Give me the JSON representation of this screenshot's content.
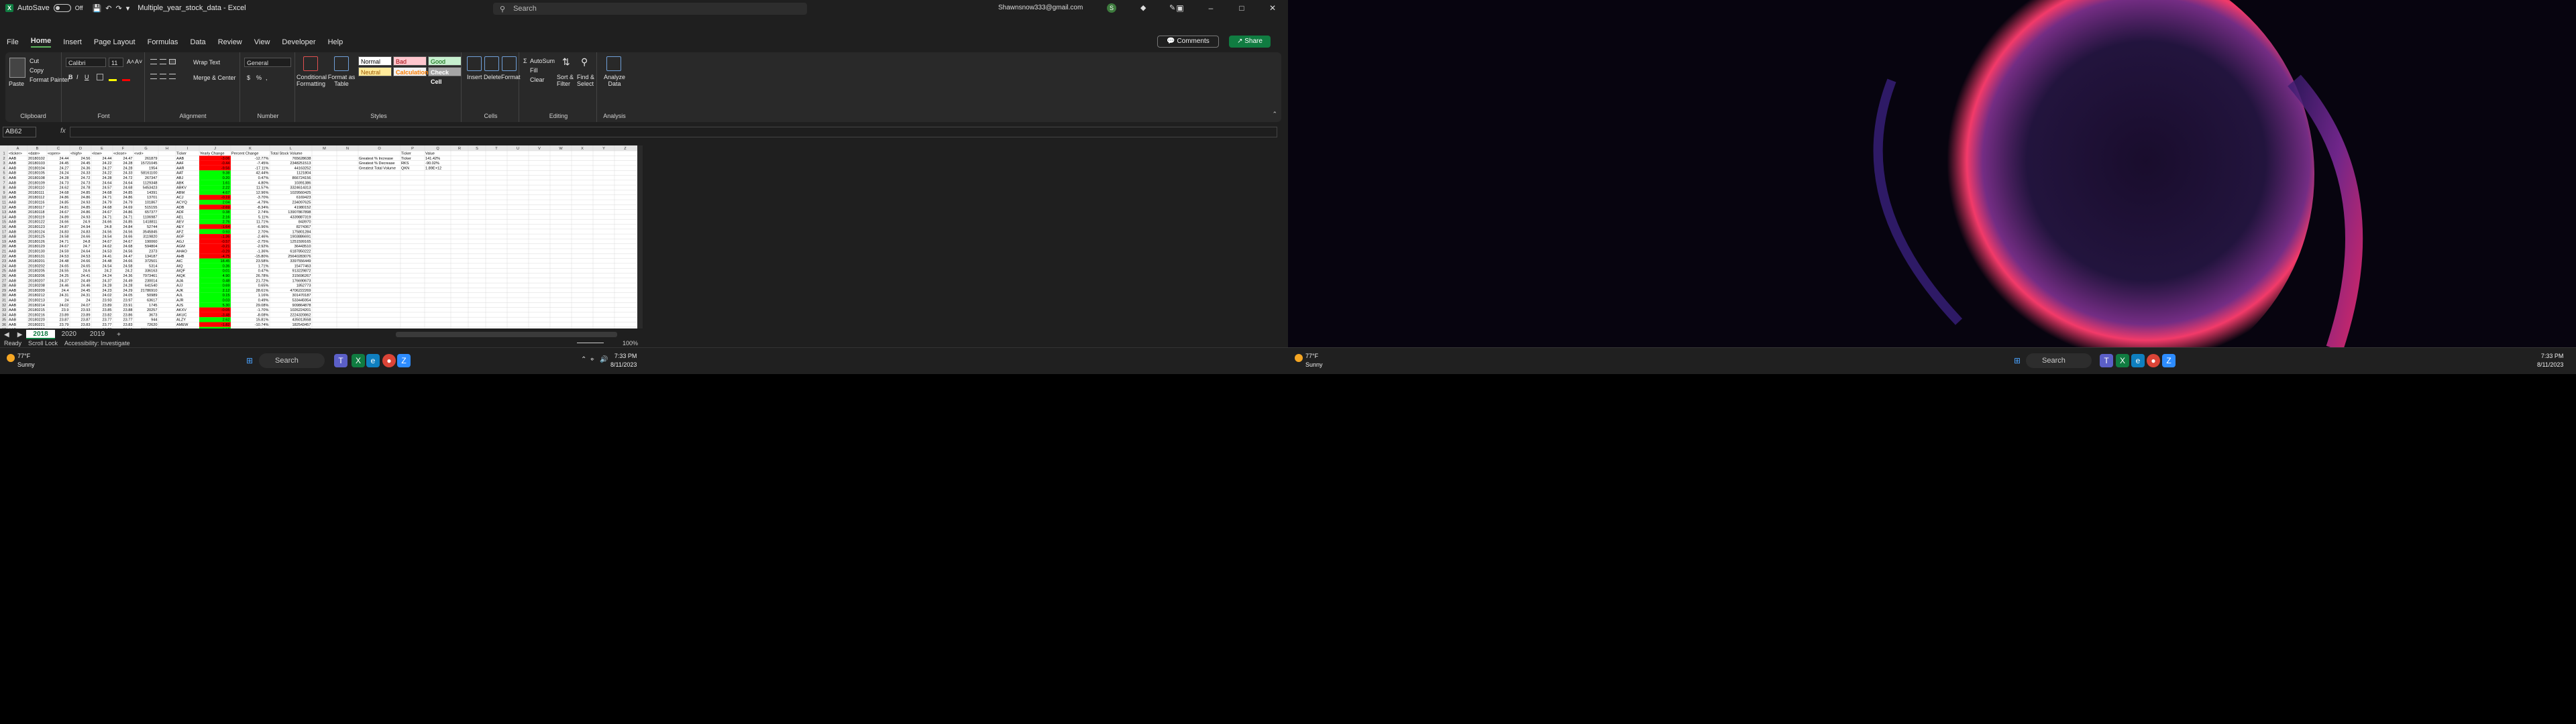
{
  "window": {
    "autosave_label": "AutoSave",
    "autosave_state": "Off",
    "doc_title": "Multiple_year_stock_data  -  Excel",
    "search_placeholder": "Search",
    "account_email": "Shawnsnow333@gmail.com",
    "avatar_letter": "S"
  },
  "menu": [
    "File",
    "Home",
    "Insert",
    "Page Layout",
    "Formulas",
    "Data",
    "Review",
    "View",
    "Developer",
    "Help"
  ],
  "menu_active": "Home",
  "buttons": {
    "comments": "Comments",
    "share": "Share"
  },
  "ribbon": {
    "clipboard": {
      "paste": "Paste",
      "cut": "Cut",
      "copy": "Copy",
      "format_painter": "Format Painter",
      "label": "Clipboard"
    },
    "font": {
      "name": "Calibri",
      "size": "11",
      "label": "Font",
      "grow": "A˄",
      "shrink": "A˅",
      "bold": "B",
      "italic": "I",
      "underline": "U"
    },
    "alignment": {
      "wrap": "Wrap Text",
      "merge": "Merge & Center",
      "label": "Alignment"
    },
    "number": {
      "format": "General",
      "label": "Number",
      "currency": "$",
      "percent": "%",
      "comma": ","
    },
    "styles": {
      "cond": "Conditional Formatting",
      "format_table": "Format as Table",
      "normal": "Normal",
      "bad": "Bad",
      "good": "Good",
      "neutral": "Neutral",
      "calculation": "Calculation",
      "check_cell": "Check Cell",
      "label": "Styles"
    },
    "cells": {
      "insert": "Insert",
      "delete": "Delete",
      "format": "Format",
      "label": "Cells"
    },
    "editing": {
      "autosum": "AutoSum",
      "fill": "Fill",
      "clear": "Clear",
      "sort": "Sort & Filter",
      "find": "Find & Select",
      "label": "Editing"
    },
    "analysis": {
      "analyze": "Analyze Data",
      "label": "Analysis"
    }
  },
  "formula": {
    "namebox": "AB62",
    "fx": "fx"
  },
  "columns": [
    "A",
    "B",
    "C",
    "D",
    "E",
    "F",
    "G",
    "H",
    "I",
    "J",
    "K",
    "L",
    "M",
    "N",
    "O",
    "P",
    "Q",
    "R",
    "S",
    "T",
    "U",
    "V",
    "W",
    "X",
    "Y",
    "Z"
  ],
  "headers": [
    "<ticker>",
    "<date>",
    "<open>",
    "<high>",
    "<low>",
    "<close>",
    "<vol>",
    "",
    "Ticker",
    "Yearly Change",
    "Percent Change",
    "Total Stock Volume"
  ],
  "rows": [
    [
      "AAB",
      "20180102",
      "24.44",
      "24.56",
      "24.44",
      "24.47",
      "261879",
      "",
      "AAB",
      "-3.06",
      "-12.77%",
      "765628638"
    ],
    [
      "AAB",
      "20180103",
      "24.45",
      "24.45",
      "24.22",
      "24.28",
      "15721045",
      "",
      "AAF",
      "-0.44",
      "-7.45%",
      "2348251513"
    ],
    [
      "AAB",
      "20180104",
      "24.27",
      "24.36",
      "24.27",
      "24.28",
      "1954",
      "",
      "AAR",
      "-9.56",
      "-17.11%",
      "44163252"
    ],
    [
      "AAB",
      "20180105",
      "24.24",
      "24.33",
      "24.22",
      "24.33",
      "58161100",
      "",
      "AAT",
      "9.38",
      "42.44%",
      "1121804"
    ],
    [
      "AAB",
      "20180108",
      "24.28",
      "24.72",
      "24.28",
      "24.72",
      "267347",
      "",
      "ABJ",
      "0.20",
      "0.47%",
      "866724156"
    ],
    [
      "AAB",
      "20180109",
      "24.73",
      "24.73",
      "24.64",
      "24.64",
      "1129348",
      "",
      "ABK",
      "1.61",
      "4.80%",
      "10391386"
    ],
    [
      "AAB",
      "20180110",
      "24.62",
      "24.78",
      "24.57",
      "24.68",
      "5453423",
      "",
      "ABKV",
      "2.22",
      "11.57%",
      "3324614313"
    ],
    [
      "AAB",
      "20180111",
      "24.68",
      "24.85",
      "24.68",
      "24.85",
      "14391",
      "",
      "ABM",
      "4.67",
      "12.96%",
      "1029560425"
    ],
    [
      "AAB",
      "20180112",
      "24.86",
      "24.86",
      "24.71",
      "24.86",
      "13701",
      "",
      "ACJ",
      "-0.19",
      "-3.70%",
      "6169423"
    ],
    [
      "AAB",
      "20180116",
      "24.85",
      "24.93",
      "24.79",
      "24.79",
      "101867",
      "",
      "ACYQ",
      "2.04",
      "-4.79%",
      "234097625"
    ],
    [
      "AAB",
      "20180117",
      "24.81",
      "24.85",
      "24.68",
      "24.69",
      "515155",
      "",
      "ADB",
      "-2.69",
      "-8.34%",
      "41980152"
    ],
    [
      "AAB",
      "20180118",
      "24.67",
      "24.86",
      "24.67",
      "24.86",
      "657377",
      "",
      "ADF",
      "0.38",
      "2.74%",
      "13907867898"
    ],
    [
      "AAB",
      "20180119",
      "24.89",
      "24.93",
      "24.71",
      "24.71",
      "1106987",
      "",
      "AEL",
      "2.16",
      "5.11%",
      "4339887319"
    ],
    [
      "AAB",
      "20180122",
      "24.66",
      "24.9",
      "24.66",
      "24.85",
      "1418811",
      "",
      "AEV",
      "2.76",
      "11.71%",
      "843970"
    ],
    [
      "AAB",
      "20180123",
      "24.87",
      "24.94",
      "24.8",
      "24.84",
      "52744",
      "",
      "AEY",
      "-1.64",
      "-6.96%",
      "8274367"
    ],
    [
      "AAB",
      "20180124",
      "24.83",
      "24.83",
      "24.56",
      "24.56",
      "3545845",
      "",
      "AFZ",
      "0.93",
      "2.70%",
      "175801284"
    ],
    [
      "AAB",
      "20180125",
      "24.58",
      "24.66",
      "24.54",
      "24.66",
      "3119820",
      "",
      "AGF",
      "-1.36",
      "-2.46%",
      "1903886691"
    ],
    [
      "AAB",
      "20180126",
      "24.71",
      "24.8",
      "24.67",
      "24.67",
      "190060",
      "",
      "AGJ",
      "-0.57",
      "-2.75%",
      "1251599165"
    ],
    [
      "AAB",
      "20180129",
      "24.67",
      "24.7",
      "24.62",
      "24.68",
      "594804",
      "",
      "AGM",
      "-0.21",
      "-2.92%",
      "36443510"
    ],
    [
      "AAB",
      "20180130",
      "24.59",
      "24.64",
      "24.53",
      "24.56",
      "2373",
      "",
      "AHAO",
      "-0.29",
      "-1.36%",
      "6187850222"
    ],
    [
      "AAB",
      "20180131",
      "24.53",
      "24.53",
      "24.41",
      "24.47",
      "134187",
      "",
      "AHB",
      "-4.75",
      "-15.80%",
      "25640283076"
    ],
    [
      "AAB",
      "20180201",
      "24.48",
      "24.66",
      "24.48",
      "24.66",
      "372501",
      "",
      "AIC",
      "18.45",
      "23.58%",
      "3397556449"
    ],
    [
      "AAB",
      "20180202",
      "24.65",
      "24.65",
      "24.54",
      "24.58",
      "5314",
      "",
      "AIQ",
      "0.36",
      "1.71%",
      "15477463"
    ],
    [
      "AAB",
      "20180205",
      "24.55",
      "24.6",
      "24.2",
      "24.2",
      "336163",
      "",
      "AIQF",
      "0.01",
      "0.47%",
      "913229872"
    ],
    [
      "AAB",
      "20180206",
      "24.25",
      "24.41",
      "24.24",
      "24.36",
      "7973461",
      "",
      "AIQK",
      "4.90",
      "26.78%",
      "315696267"
    ],
    [
      "AAB",
      "20180207",
      "24.37",
      "24.49",
      "24.37",
      "24.49",
      "230014",
      "",
      "AJA",
      "0.48",
      "21.72%",
      "176690673"
    ],
    [
      "AAB",
      "20180208",
      "24.46",
      "24.46",
      "24.28",
      "24.28",
      "641540",
      "",
      "AJJ",
      "0.69",
      "0.65%",
      "1852773"
    ],
    [
      "AAB",
      "20180209",
      "24.4",
      "24.45",
      "24.23",
      "24.29",
      "21786910",
      "",
      "AJK",
      "2.12",
      "28.61%",
      "4706222269"
    ],
    [
      "AAB",
      "20180212",
      "24.31",
      "24.31",
      "24.02",
      "24.05",
      "50989",
      "",
      "AJL",
      "0.15",
      "1.16%",
      "301470187"
    ],
    [
      "AAB",
      "20180213",
      "24",
      "24",
      "23.93",
      "23.97",
      "63617",
      "",
      "AJR",
      "0.03",
      "0.49%",
      "533445954"
    ],
    [
      "AAB",
      "20180214",
      "24.02",
      "24.07",
      "23.89",
      "23.91",
      "1745",
      "",
      "AJS",
      "5.30",
      "29.08%",
      "909864878"
    ],
    [
      "AAB",
      "20180215",
      "23.9",
      "23.93",
      "23.85",
      "23.88",
      "20257",
      "",
      "AKXV",
      "-0.05",
      "-1.70%",
      "1026224201"
    ],
    [
      "AAB",
      "20180216",
      "23.89",
      "23.89",
      "23.82",
      "23.86",
      "3673",
      "",
      "AKUC",
      "-3.48",
      "-8.08%",
      "2224320862"
    ],
    [
      "AAB",
      "20180220",
      "23.87",
      "23.87",
      "23.77",
      "23.77",
      "944",
      "",
      "ALZY",
      "2.62",
      "15.81%",
      "435013558"
    ],
    [
      "AAB",
      "20180221",
      "23.79",
      "23.83",
      "23.77",
      "23.83",
      "72620",
      "",
      "AMEW",
      "-1.82",
      "-10.74%",
      "182543457"
    ],
    [
      "AAB",
      "20180222",
      "23.8",
      "23.84",
      "23.77",
      "23.93",
      "22611665",
      "",
      "AMX",
      "1.12",
      "2.43%",
      "3857538843"
    ]
  ],
  "summary": {
    "headers": [
      "",
      "Ticker",
      "Value"
    ],
    "rows": [
      [
        "Greatest % Increase",
        "Ticker",
        "141.42%"
      ],
      [
        "Greatest % Decrease",
        "RKS",
        "-90.02%"
      ],
      [
        "Greatest Total Volume",
        "QKN",
        "1.89E+12"
      ]
    ]
  },
  "sheets": [
    "2018",
    "2020",
    "2019"
  ],
  "active_sheet": "2018",
  "status": {
    "ready": "Ready",
    "scroll_lock": "Scroll Lock",
    "accessibility": "Accessibility: Investigate",
    "zoom": "100%"
  },
  "taskbar": {
    "weather_temp": "77°F",
    "weather_desc": "Sunny",
    "search": "Search",
    "time": "7:33 PM",
    "date": "8/11/2023"
  },
  "colors": {
    "excel_green": "#107c41",
    "positive": "#00ff00",
    "negative": "#ff0000"
  }
}
